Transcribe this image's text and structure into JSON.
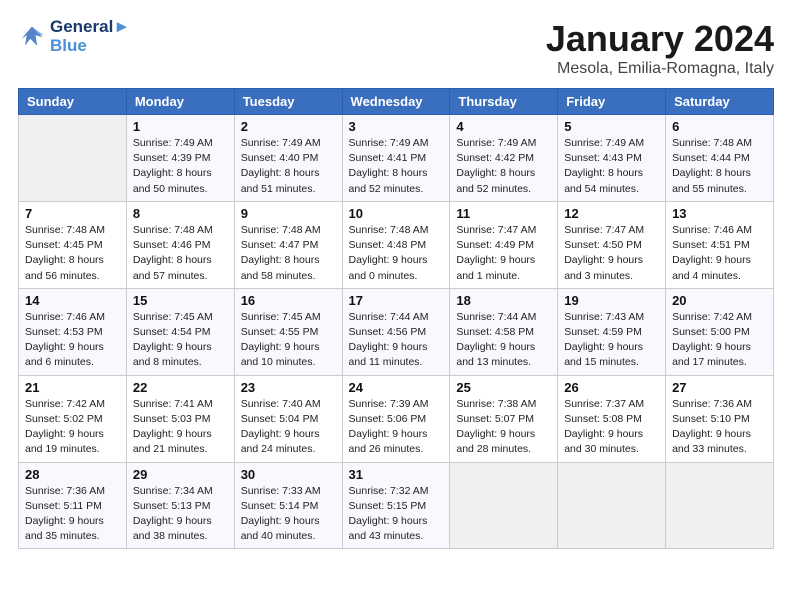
{
  "header": {
    "logo_line1": "General",
    "logo_line2": "Blue",
    "month": "January 2024",
    "location": "Mesola, Emilia-Romagna, Italy"
  },
  "weekdays": [
    "Sunday",
    "Monday",
    "Tuesday",
    "Wednesday",
    "Thursday",
    "Friday",
    "Saturday"
  ],
  "weeks": [
    [
      {
        "day": "",
        "info": ""
      },
      {
        "day": "1",
        "info": "Sunrise: 7:49 AM\nSunset: 4:39 PM\nDaylight: 8 hours\nand 50 minutes."
      },
      {
        "day": "2",
        "info": "Sunrise: 7:49 AM\nSunset: 4:40 PM\nDaylight: 8 hours\nand 51 minutes."
      },
      {
        "day": "3",
        "info": "Sunrise: 7:49 AM\nSunset: 4:41 PM\nDaylight: 8 hours\nand 52 minutes."
      },
      {
        "day": "4",
        "info": "Sunrise: 7:49 AM\nSunset: 4:42 PM\nDaylight: 8 hours\nand 52 minutes."
      },
      {
        "day": "5",
        "info": "Sunrise: 7:49 AM\nSunset: 4:43 PM\nDaylight: 8 hours\nand 54 minutes."
      },
      {
        "day": "6",
        "info": "Sunrise: 7:48 AM\nSunset: 4:44 PM\nDaylight: 8 hours\nand 55 minutes."
      }
    ],
    [
      {
        "day": "7",
        "info": "Sunrise: 7:48 AM\nSunset: 4:45 PM\nDaylight: 8 hours\nand 56 minutes."
      },
      {
        "day": "8",
        "info": "Sunrise: 7:48 AM\nSunset: 4:46 PM\nDaylight: 8 hours\nand 57 minutes."
      },
      {
        "day": "9",
        "info": "Sunrise: 7:48 AM\nSunset: 4:47 PM\nDaylight: 8 hours\nand 58 minutes."
      },
      {
        "day": "10",
        "info": "Sunrise: 7:48 AM\nSunset: 4:48 PM\nDaylight: 9 hours\nand 0 minutes."
      },
      {
        "day": "11",
        "info": "Sunrise: 7:47 AM\nSunset: 4:49 PM\nDaylight: 9 hours\nand 1 minute."
      },
      {
        "day": "12",
        "info": "Sunrise: 7:47 AM\nSunset: 4:50 PM\nDaylight: 9 hours\nand 3 minutes."
      },
      {
        "day": "13",
        "info": "Sunrise: 7:46 AM\nSunset: 4:51 PM\nDaylight: 9 hours\nand 4 minutes."
      }
    ],
    [
      {
        "day": "14",
        "info": "Sunrise: 7:46 AM\nSunset: 4:53 PM\nDaylight: 9 hours\nand 6 minutes."
      },
      {
        "day": "15",
        "info": "Sunrise: 7:45 AM\nSunset: 4:54 PM\nDaylight: 9 hours\nand 8 minutes."
      },
      {
        "day": "16",
        "info": "Sunrise: 7:45 AM\nSunset: 4:55 PM\nDaylight: 9 hours\nand 10 minutes."
      },
      {
        "day": "17",
        "info": "Sunrise: 7:44 AM\nSunset: 4:56 PM\nDaylight: 9 hours\nand 11 minutes."
      },
      {
        "day": "18",
        "info": "Sunrise: 7:44 AM\nSunset: 4:58 PM\nDaylight: 9 hours\nand 13 minutes."
      },
      {
        "day": "19",
        "info": "Sunrise: 7:43 AM\nSunset: 4:59 PM\nDaylight: 9 hours\nand 15 minutes."
      },
      {
        "day": "20",
        "info": "Sunrise: 7:42 AM\nSunset: 5:00 PM\nDaylight: 9 hours\nand 17 minutes."
      }
    ],
    [
      {
        "day": "21",
        "info": "Sunrise: 7:42 AM\nSunset: 5:02 PM\nDaylight: 9 hours\nand 19 minutes."
      },
      {
        "day": "22",
        "info": "Sunrise: 7:41 AM\nSunset: 5:03 PM\nDaylight: 9 hours\nand 21 minutes."
      },
      {
        "day": "23",
        "info": "Sunrise: 7:40 AM\nSunset: 5:04 PM\nDaylight: 9 hours\nand 24 minutes."
      },
      {
        "day": "24",
        "info": "Sunrise: 7:39 AM\nSunset: 5:06 PM\nDaylight: 9 hours\nand 26 minutes."
      },
      {
        "day": "25",
        "info": "Sunrise: 7:38 AM\nSunset: 5:07 PM\nDaylight: 9 hours\nand 28 minutes."
      },
      {
        "day": "26",
        "info": "Sunrise: 7:37 AM\nSunset: 5:08 PM\nDaylight: 9 hours\nand 30 minutes."
      },
      {
        "day": "27",
        "info": "Sunrise: 7:36 AM\nSunset: 5:10 PM\nDaylight: 9 hours\nand 33 minutes."
      }
    ],
    [
      {
        "day": "28",
        "info": "Sunrise: 7:36 AM\nSunset: 5:11 PM\nDaylight: 9 hours\nand 35 minutes."
      },
      {
        "day": "29",
        "info": "Sunrise: 7:34 AM\nSunset: 5:13 PM\nDaylight: 9 hours\nand 38 minutes."
      },
      {
        "day": "30",
        "info": "Sunrise: 7:33 AM\nSunset: 5:14 PM\nDaylight: 9 hours\nand 40 minutes."
      },
      {
        "day": "31",
        "info": "Sunrise: 7:32 AM\nSunset: 5:15 PM\nDaylight: 9 hours\nand 43 minutes."
      },
      {
        "day": "",
        "info": ""
      },
      {
        "day": "",
        "info": ""
      },
      {
        "day": "",
        "info": ""
      }
    ]
  ]
}
